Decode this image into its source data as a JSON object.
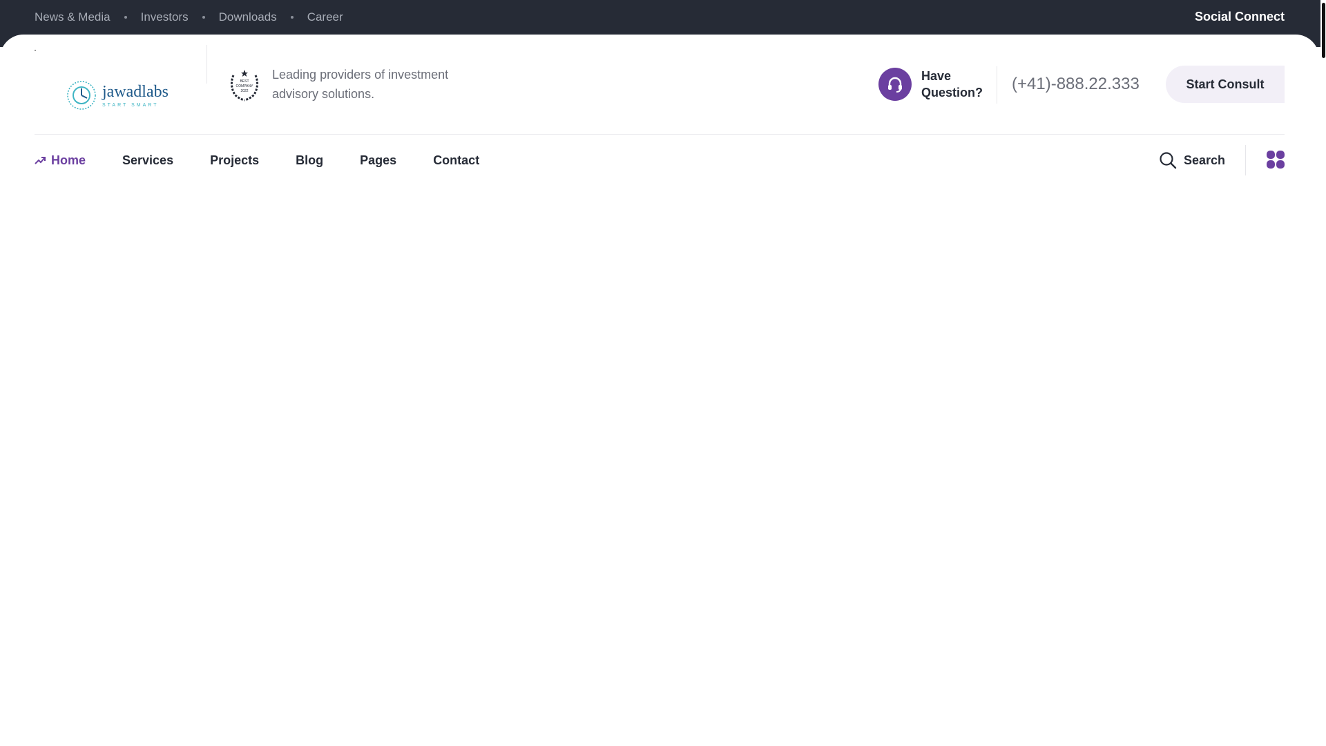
{
  "topbar": {
    "links": [
      "News & Media",
      "Investors",
      "Downloads",
      "Career"
    ],
    "social_label": "Social Connect"
  },
  "header": {
    "logo_text": "jawadlabs",
    "logo_tagline": "START SMART",
    "badge_lines": [
      "BEST",
      "COMPANY",
      "2022"
    ],
    "tagline": "Leading providers of investment advisory solutions.",
    "question_label": "Have Question?",
    "phone": "(+41)-888.22.333",
    "consult_label": "Start Consult"
  },
  "nav": {
    "items": [
      "Home",
      "Services",
      "Projects",
      "Blog",
      "Pages",
      "Contact"
    ],
    "active": "Home",
    "search_label": "Search"
  },
  "colors": {
    "topbar_bg": "#262b36",
    "accent": "#6b3fa0",
    "text_dark": "#262b36",
    "text_muted": "#6b6e78",
    "logo_blue": "#1f5a8a",
    "logo_teal": "#3fb5c4"
  },
  "icons": {
    "question": "headset-icon",
    "home": "trending-up-icon",
    "search": "search-icon",
    "menu": "grid-icon",
    "badge": "laurel-award-icon"
  }
}
